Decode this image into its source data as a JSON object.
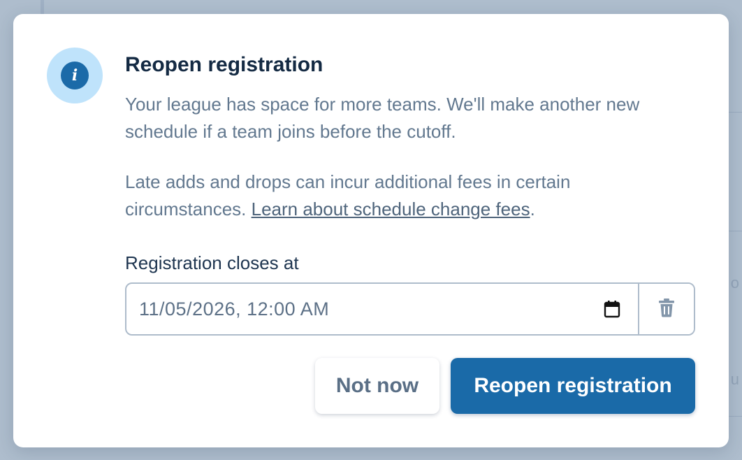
{
  "modal": {
    "title": "Reopen registration",
    "icon": "info-icon",
    "icon_glyph": "i",
    "paragraph1": "Your league has space for more teams. We'll make another new schedule if a team joins before the cutoff.",
    "paragraph2_text": "Late adds and drops can incur additional fees in certain circumstances. ",
    "paragraph2_link": "Learn about schedule change fees",
    "paragraph2_suffix": ".",
    "field_label": "Registration closes at",
    "date_value": "11/05/2026, 12:00 AM",
    "calendar_icon": "calendar-icon",
    "delete_icon": "trash-icon",
    "cancel_label": "Not now",
    "confirm_label": "Reopen registration"
  },
  "background": {
    "fragment1": "o",
    "fragment2": "u"
  },
  "colors": {
    "primary": "#1a6aa8",
    "icon_bg": "#bfe3fb",
    "title": "#142a43",
    "body_text": "#62788f",
    "border": "#aebccb",
    "overlay": "#aebdcd"
  }
}
